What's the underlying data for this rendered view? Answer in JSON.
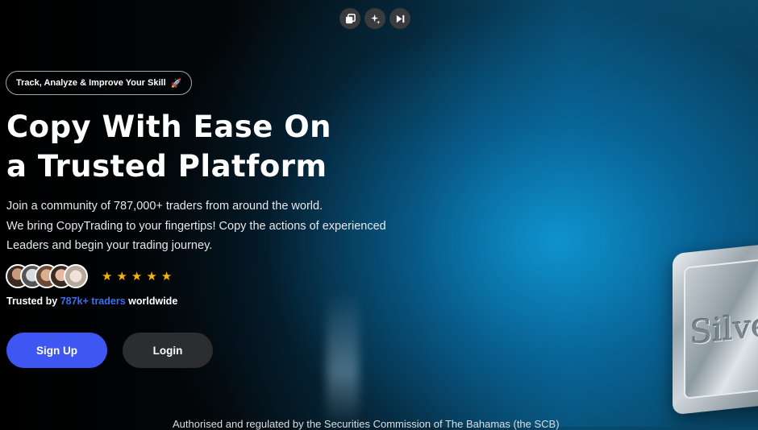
{
  "toolbar": {
    "icons": [
      "copy-icon",
      "sparkle-icon",
      "skip-forward-icon"
    ]
  },
  "hero": {
    "tag_label": "Track, Analyze & Improve Your Skill",
    "tag_icon": "rocket-icon",
    "headline_line1": "Copy With Ease On",
    "headline_line2": "a Trusted Platform",
    "subtext_line1": "Join a community of 787,000+ traders from around the world.",
    "subtext_line2": "We bring CopyTrading to your fingertips! Copy the actions of experienced",
    "subtext_line3": "Leaders and begin your trading journey.",
    "rating_stars": 5,
    "trusted_prefix": "Trusted by",
    "trusted_highlight": "787k+ traders",
    "trusted_suffix": "worldwide"
  },
  "actions": {
    "signup_label": "Sign Up",
    "login_label": "Login"
  },
  "card": {
    "text": "Silver"
  },
  "footer": {
    "text": "Authorised and regulated by the Securities Commission of The Bahamas (the SCB)"
  },
  "colors": {
    "accent": "#3e57f2",
    "highlight": "#3b6ef6",
    "star": "#f5b500"
  }
}
